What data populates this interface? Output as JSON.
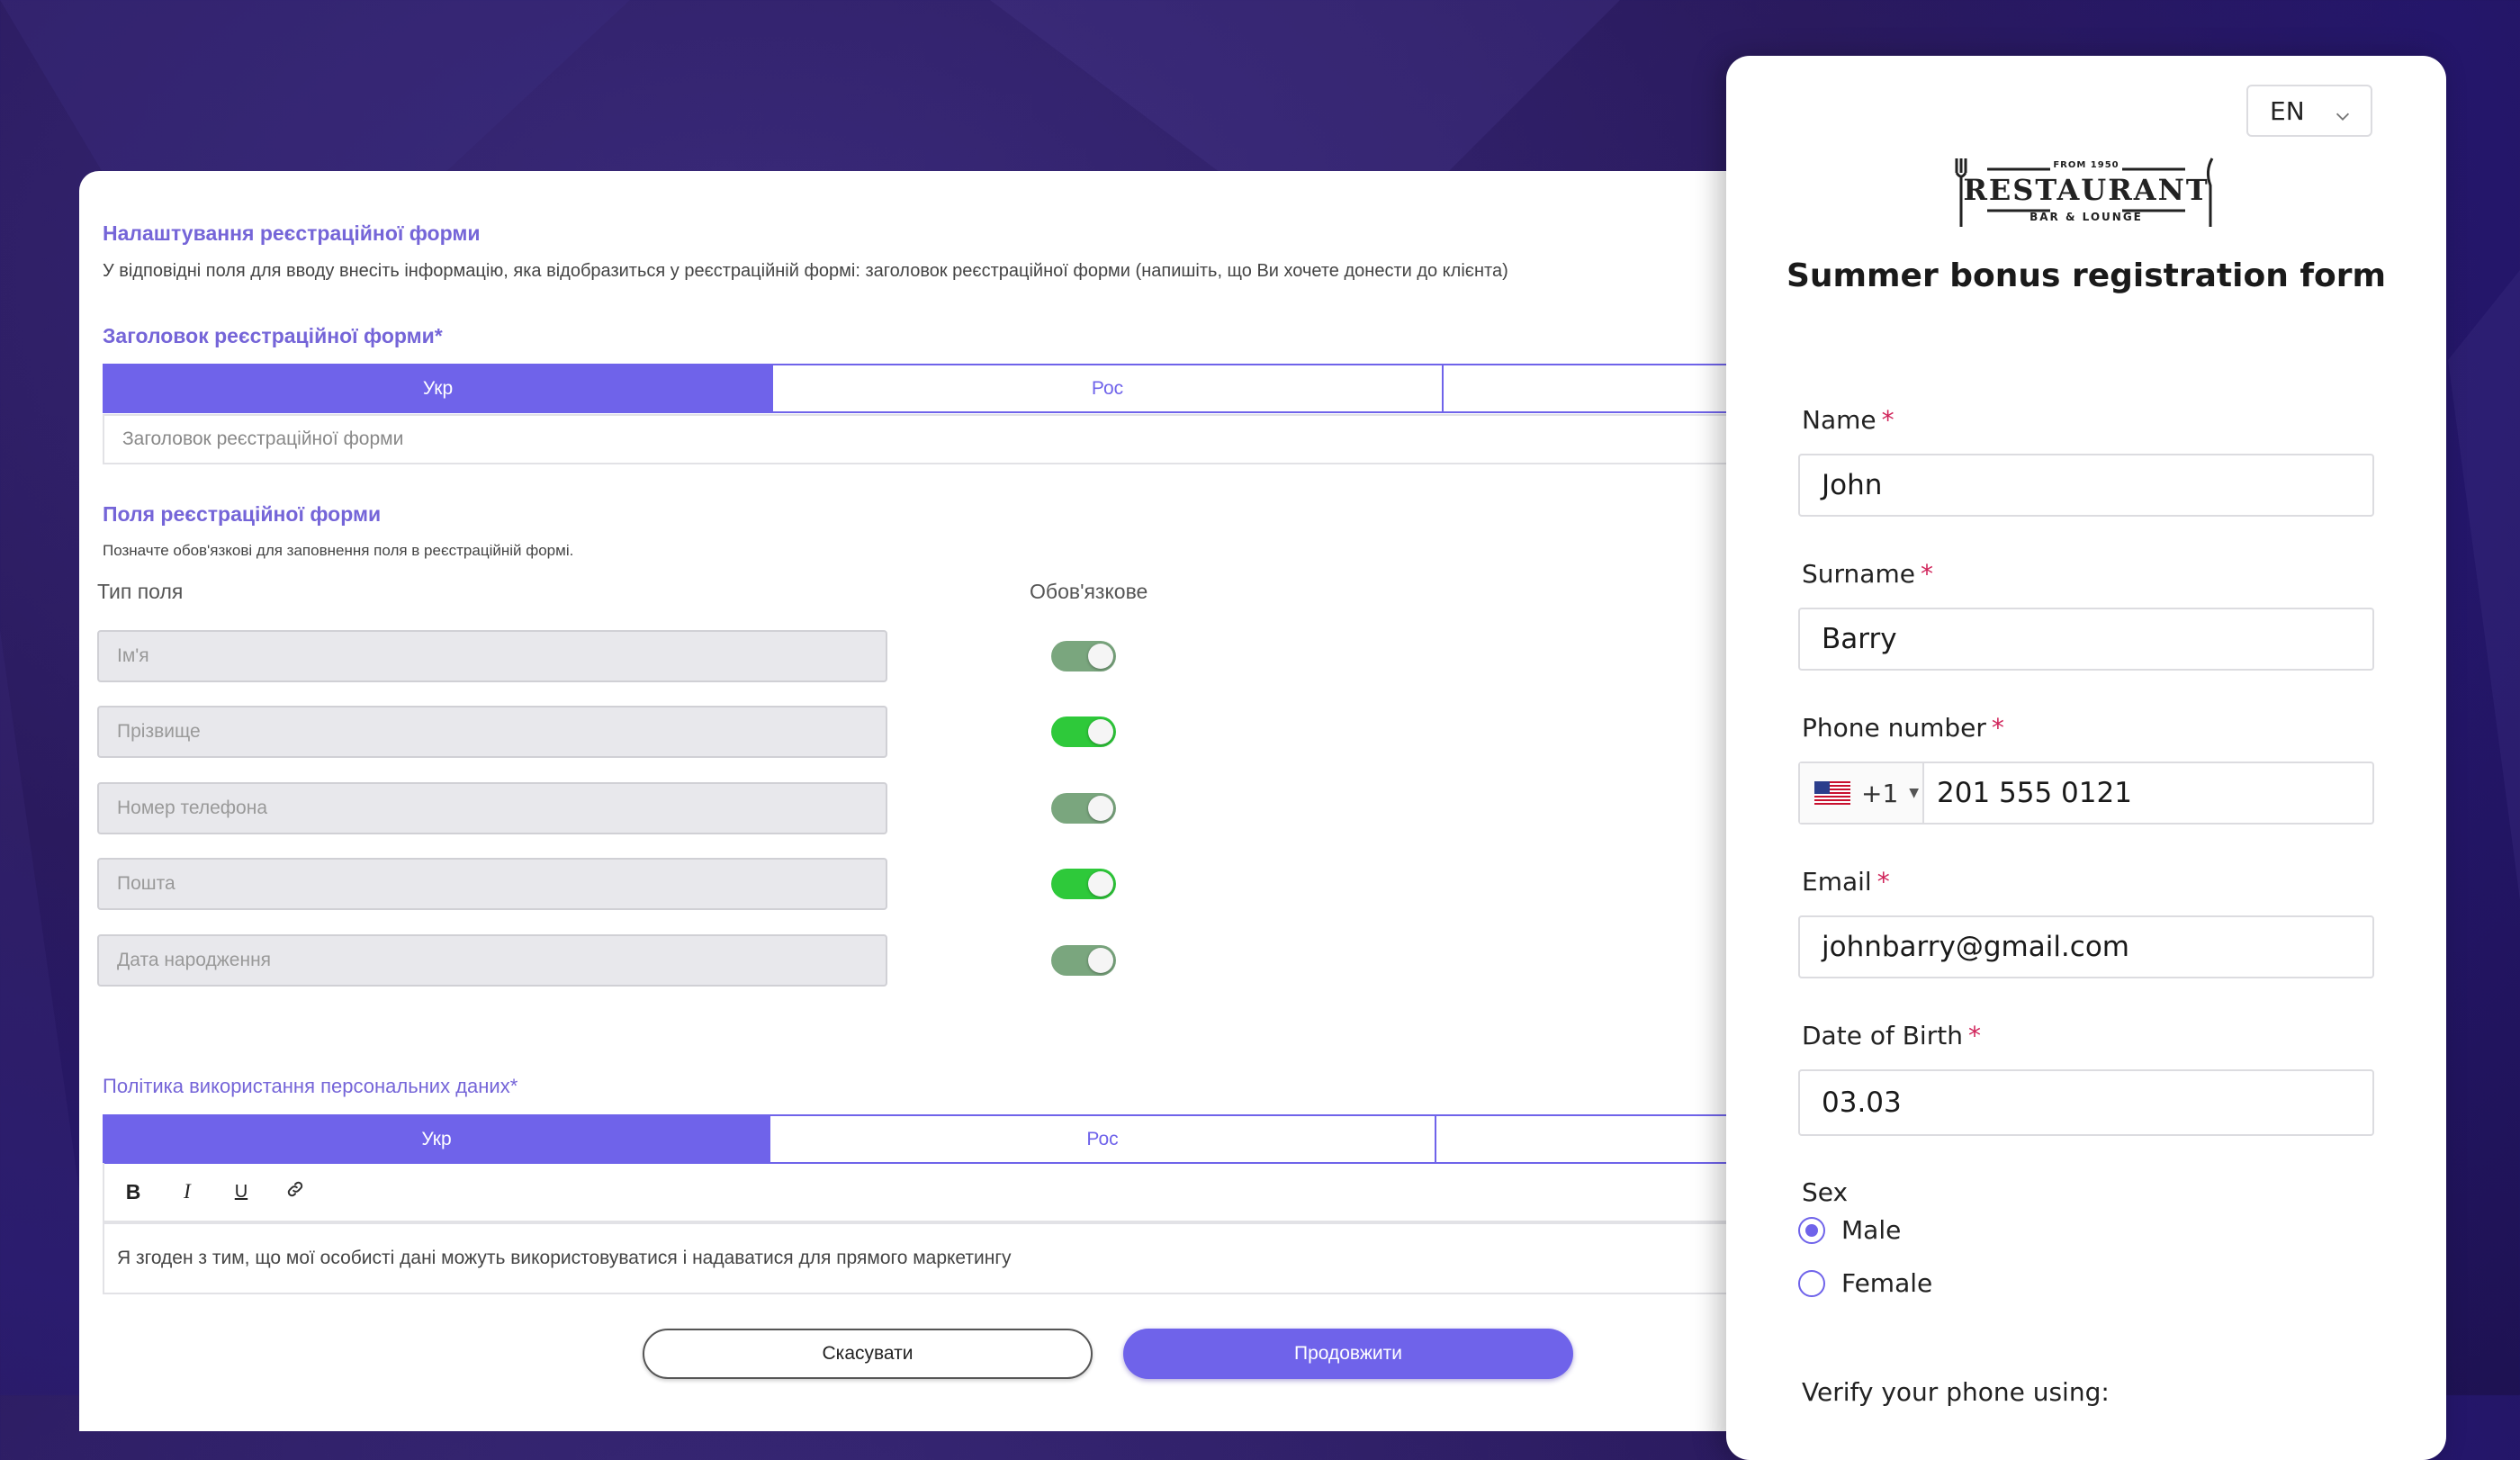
{
  "admin": {
    "settings_title": "Налаштування реєстраційної форми",
    "settings_desc": "У відповідні поля для вводу внесіть інформацію, яка відобразиться у реєстраційній формі: заголовок реєстраційної форми (напишіть, що Ви хочете донести до клієнта)",
    "header_title": "Заголовок реєстраційної форми*",
    "header_tabs": [
      {
        "label": "Укр",
        "active": true
      },
      {
        "label": "Рос",
        "active": false
      },
      {
        "label": "",
        "active": false
      }
    ],
    "header_placeholder": "Заголовок реєстраційної форми",
    "fields_title": "Поля реєстраційної форми",
    "fields_desc": "Позначте обов'язкові для заповнення поля в реєстраційній формі.",
    "col_type": "Тип поля",
    "col_required": "Обов'язкове",
    "fields": [
      {
        "label": "Ім'я",
        "enabled": true,
        "color": "#7aa67e"
      },
      {
        "label": "Прізвище",
        "enabled": true,
        "color": "#2ec93a"
      },
      {
        "label": "Номер телефона",
        "enabled": true,
        "color": "#7aa67e"
      },
      {
        "label": "Пошта",
        "enabled": true,
        "color": "#2ec93a"
      },
      {
        "label": "Дата народження",
        "enabled": true,
        "color": "#7aa67e"
      }
    ],
    "policy_title": "Політика використання персональних даних*",
    "policy_tabs": [
      {
        "label": "Укр",
        "active": true
      },
      {
        "label": "Рос",
        "active": false
      },
      {
        "label": "",
        "active": false
      }
    ],
    "toolbar": {
      "bold": "B",
      "italic": "I",
      "underline": "U"
    },
    "policy_text": "Я згоден з тим, що мої особисті дані можуть використовуватися і надаватися для прямого маркетингу",
    "cancel_label": "Скасувати",
    "continue_label": "Продовжити"
  },
  "preview": {
    "language": "EN",
    "logo": {
      "top": "FROM 1950",
      "main": "RESTAURANT",
      "bottom": "BAR & LOUNGE"
    },
    "form_title": "Summer bonus registration form",
    "name_label": "Name",
    "name_value": "John",
    "surname_label": "Surname",
    "surname_value": "Barry",
    "phone_label": "Phone number",
    "phone_code": "+1",
    "phone_value": "201 555 0121",
    "email_label": "Email",
    "email_value": "johnbarry@gmail.com",
    "dob_label": "Date of Birth",
    "dob_value": "03.03",
    "required_mark": "*",
    "sex_label": "Sex",
    "sex_options": [
      {
        "label": "Male",
        "checked": true
      },
      {
        "label": "Female",
        "checked": false
      }
    ],
    "verify_label": "Verify your phone using:"
  },
  "colors": {
    "accent": "#6f63ea",
    "heading": "#7565d8",
    "required": "#d0245a"
  }
}
